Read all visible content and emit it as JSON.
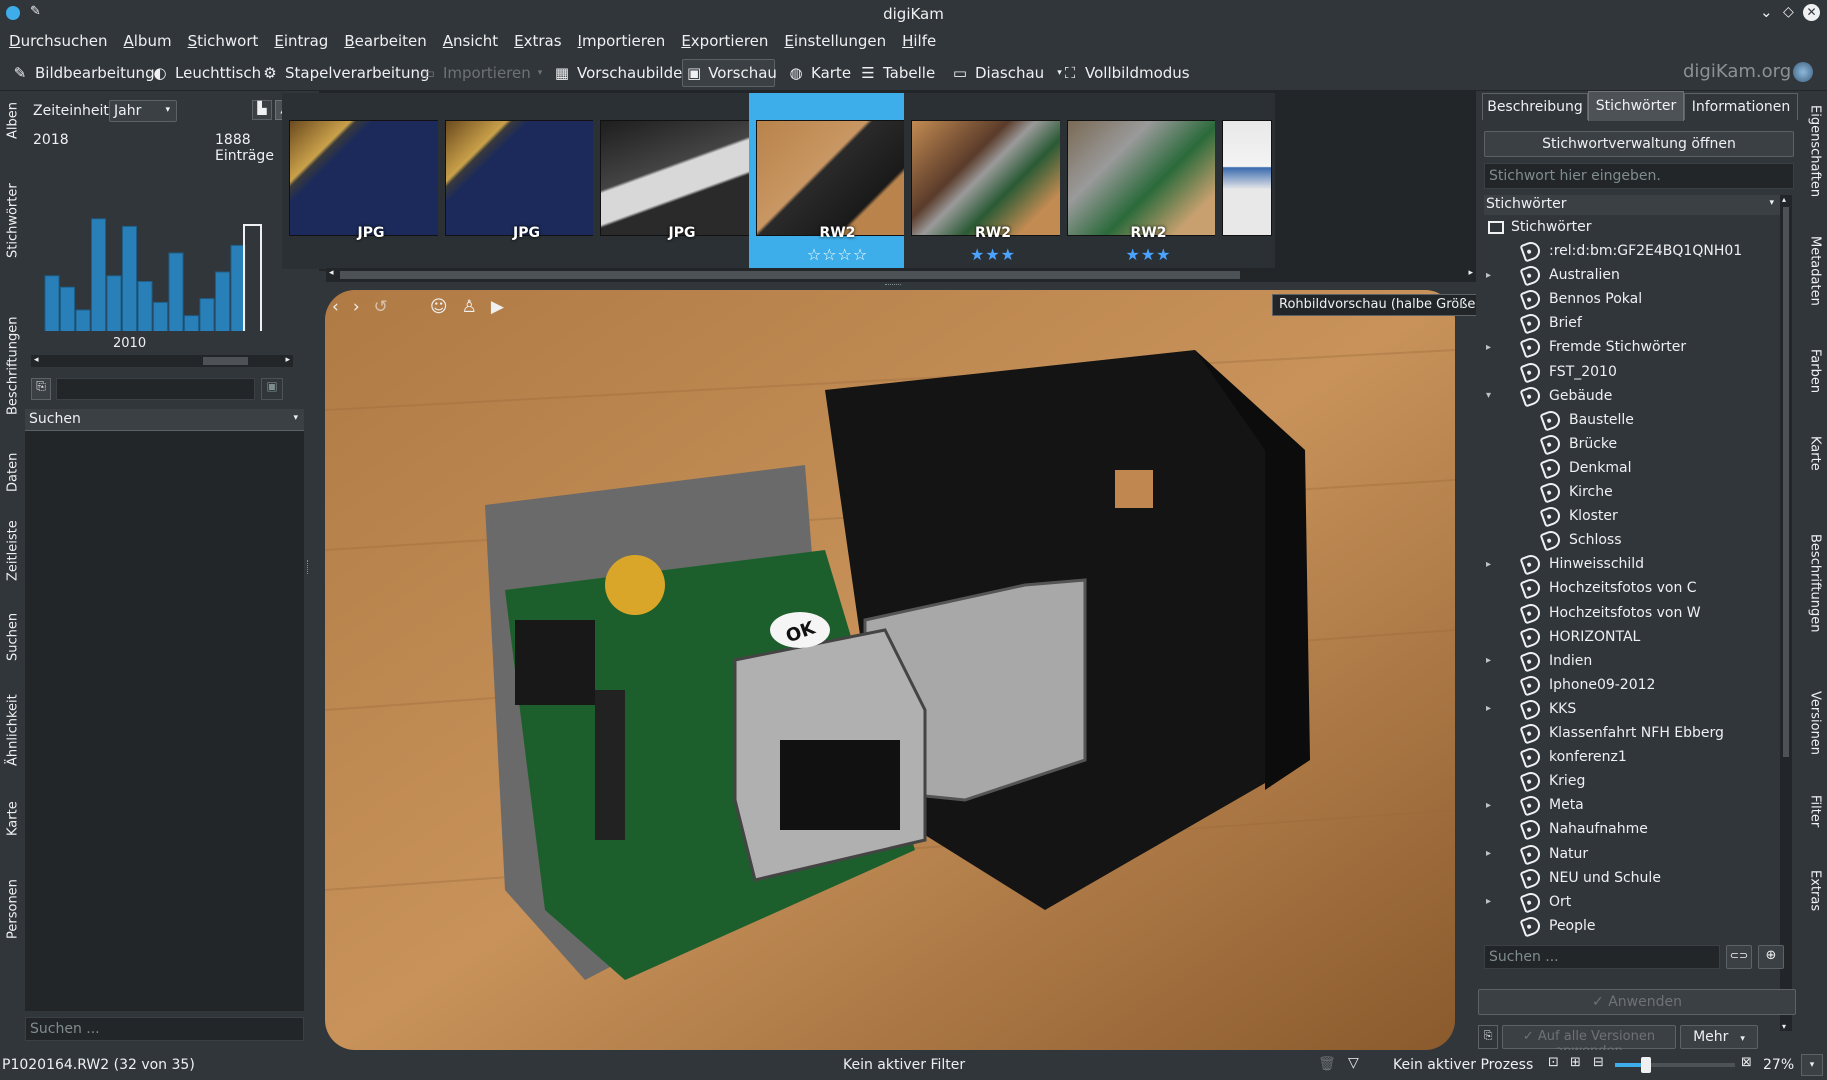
{
  "window": {
    "title": "digiKam"
  },
  "menu": [
    "Durchsuchen",
    "Album",
    "Stichwort",
    "Eintrag",
    "Bearbeiten",
    "Ansicht",
    "Extras",
    "Importieren",
    "Exportieren",
    "Einstellungen",
    "Hilfe"
  ],
  "toolbar": {
    "bildbearbeitung": "Bildbearbeitung",
    "leuchttisch": "Leuchttisch",
    "stapel": "Stapelverarbeitung",
    "importieren": "Importieren",
    "vorschaubilder": "Vorschaubilder",
    "vorschau": "Vorschau",
    "karte": "Karte",
    "tabelle": "Tabelle",
    "diaschau": "Diaschau",
    "vollbild": "Vollbildmodus",
    "brand": "digiKam.org"
  },
  "left_tabs": [
    "Alben",
    "Stichwörter",
    "Beschriftungen",
    "Daten",
    "Zeitleiste",
    "Suchen",
    "Ähnlichkeit",
    "Karte",
    "Personen"
  ],
  "timeline": {
    "label": "Zeiteinheit:",
    "unit": "Jahr",
    "year_start": "2018",
    "count": "1888 Einträge",
    "axis_year": "2010",
    "search_header": "Suchen",
    "search_placeholder": "Suchen ..."
  },
  "timeline_bars": [
    0.48,
    0.42,
    0.3,
    0.78,
    0.48,
    0.74,
    0.45,
    0.34,
    0.6,
    0.27,
    0.36,
    0.5,
    0.64
  ],
  "thumbnails": [
    {
      "badge": "JPG",
      "stars": "",
      "kind": "screen"
    },
    {
      "badge": "JPG",
      "stars": "",
      "kind": "screen"
    },
    {
      "badge": "JPG",
      "stars": "",
      "kind": "label"
    },
    {
      "badge": "RW2",
      "stars": "☆☆☆☆",
      "kind": "pi",
      "selected": true
    },
    {
      "badge": "RW2",
      "stars": "★★★",
      "kind": "pi2"
    },
    {
      "badge": "RW2",
      "stars": "★★★",
      "kind": "pi3"
    },
    {
      "badge": "",
      "stars": "",
      "kind": "web"
    }
  ],
  "preview": {
    "tooltip": "Rohbildvorschau (halbe Größe)"
  },
  "right": {
    "tabs": [
      "Beschreibung",
      "Stichwörter",
      "Informationen"
    ],
    "manage_button": "Stichwortverwaltung öffnen",
    "input_placeholder": "Stichwort hier eingeben.",
    "combo": "Stichwörter",
    "root": "Stichwörter",
    "search_placeholder": "Suchen ...",
    "apply": "✓ Anwenden",
    "apply_all": "✓ Auf alle Versionen anwenden",
    "more": "Mehr"
  },
  "tags": [
    {
      "label": ":rel:d:bm:GF2E4BQ1QNH01",
      "level": 1,
      "expander": ""
    },
    {
      "label": "Australien",
      "level": 1,
      "expander": "▸"
    },
    {
      "label": "Bennos Pokal",
      "level": 1,
      "expander": ""
    },
    {
      "label": "Brief",
      "level": 1,
      "expander": ""
    },
    {
      "label": "Fremde Stichwörter",
      "level": 1,
      "expander": "▸"
    },
    {
      "label": "FST_2010",
      "level": 1,
      "expander": ""
    },
    {
      "label": "Gebäude",
      "level": 1,
      "expander": "▾"
    },
    {
      "label": "Baustelle",
      "level": 2,
      "expander": ""
    },
    {
      "label": "Brücke",
      "level": 2,
      "expander": ""
    },
    {
      "label": "Denkmal",
      "level": 2,
      "expander": ""
    },
    {
      "label": "Kirche",
      "level": 2,
      "expander": ""
    },
    {
      "label": "Kloster",
      "level": 2,
      "expander": ""
    },
    {
      "label": "Schloss",
      "level": 2,
      "expander": ""
    },
    {
      "label": "Hinweisschild",
      "level": 1,
      "expander": "▸"
    },
    {
      "label": "Hochzeitsfotos von C",
      "level": 1,
      "expander": ""
    },
    {
      "label": "Hochzeitsfotos von W",
      "level": 1,
      "expander": ""
    },
    {
      "label": "HORIZONTAL",
      "level": 1,
      "expander": ""
    },
    {
      "label": "Indien",
      "level": 1,
      "expander": "▸"
    },
    {
      "label": "Iphone09-2012",
      "level": 1,
      "expander": ""
    },
    {
      "label": "KKS",
      "level": 1,
      "expander": "▸"
    },
    {
      "label": "Klassenfahrt NFH Ebberg",
      "level": 1,
      "expander": ""
    },
    {
      "label": "konferenz1",
      "level": 1,
      "expander": ""
    },
    {
      "label": "Krieg",
      "level": 1,
      "expander": ""
    },
    {
      "label": "Meta",
      "level": 1,
      "expander": "▸"
    },
    {
      "label": "Nahaufnahme",
      "level": 1,
      "expander": ""
    },
    {
      "label": "Natur",
      "level": 1,
      "expander": "▸"
    },
    {
      "label": "NEU und Schule",
      "level": 1,
      "expander": ""
    },
    {
      "label": "Ort",
      "level": 1,
      "expander": "▸"
    },
    {
      "label": "People",
      "level": 1,
      "expander": ""
    }
  ],
  "right_tabs": [
    "Eigenschaften",
    "Metadaten",
    "Farben",
    "Karte",
    "Beschriftungen",
    "Versionen",
    "Filter",
    "Extras"
  ],
  "status": {
    "file": "P1020164.RW2 (32 von 35)",
    "filter": "Kein aktiver Filter",
    "process": "Kein aktiver Prozess",
    "zoom": "27%"
  },
  "colors": {
    "accent": "#3daee9",
    "bg": "#31363b",
    "dark": "#232629",
    "bar": "#2980b9"
  }
}
